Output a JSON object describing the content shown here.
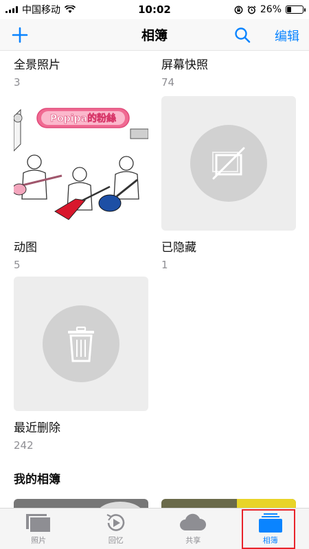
{
  "status": {
    "carrier": "中国移动",
    "time": "10:02",
    "battery": "26%",
    "battery_level": 0.26
  },
  "nav": {
    "title": "相簿",
    "edit_label": "编辑"
  },
  "albums": [
    {
      "name": "全景照片",
      "count": "3"
    },
    {
      "name": "屏幕快照",
      "count": "74"
    },
    {
      "name": "动图",
      "count": "5",
      "banner_text": "Popipa的粉絲"
    },
    {
      "name": "已隐藏",
      "count": "1"
    },
    {
      "name": "最近删除",
      "count": "242"
    }
  ],
  "section": {
    "my_albums": "我的相簿"
  },
  "tabs": [
    {
      "label": "照片",
      "icon": "photos-icon"
    },
    {
      "label": "回忆",
      "icon": "memories-icon"
    },
    {
      "label": "共享",
      "icon": "shared-cloud-icon"
    },
    {
      "label": "相簿",
      "icon": "albums-icon",
      "active": true
    }
  ],
  "colors": {
    "accent": "#0a84ff",
    "highlight": "#e8232a"
  }
}
